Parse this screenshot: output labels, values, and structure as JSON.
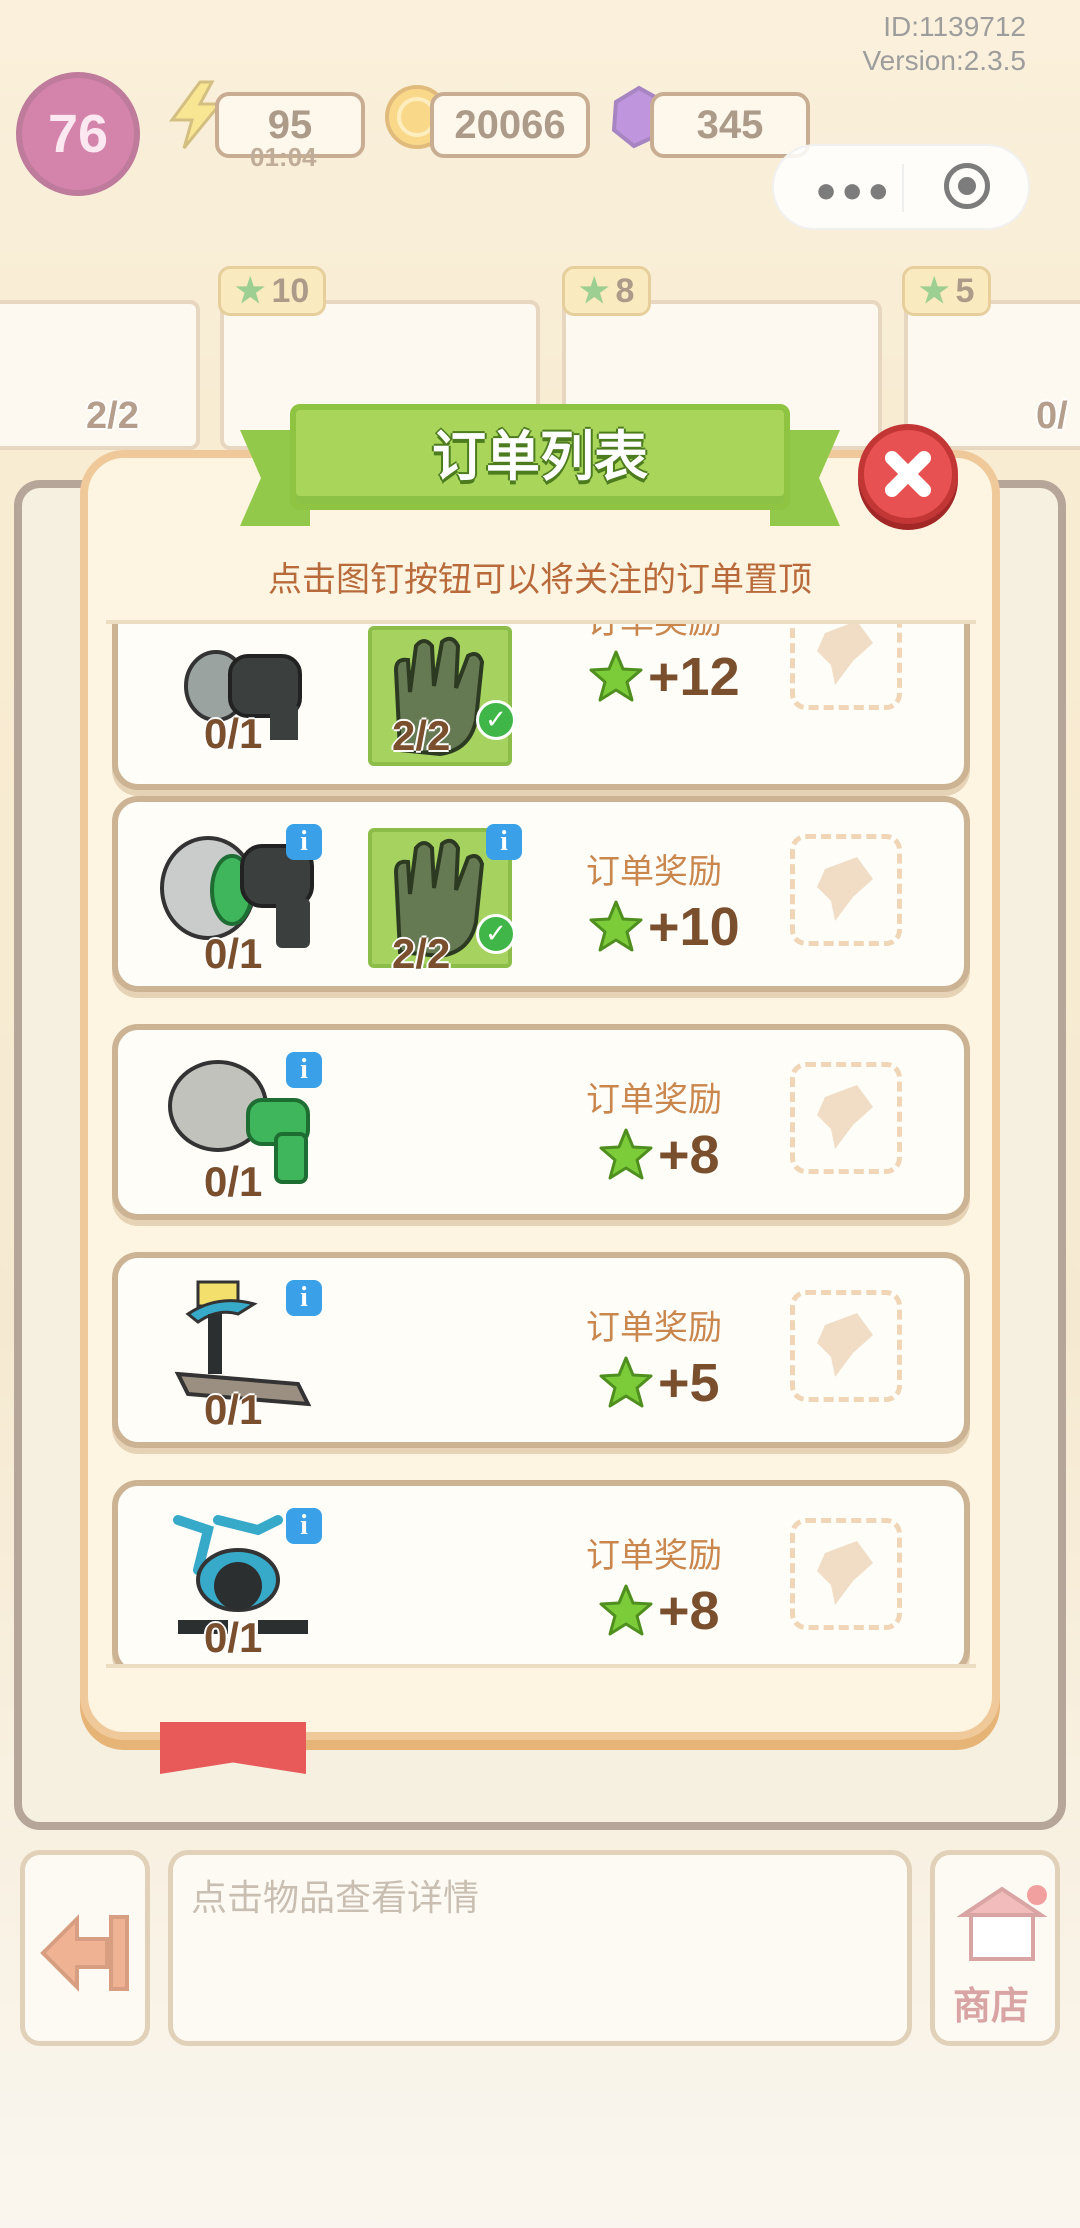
{
  "system": {
    "id_text": "ID:1139712",
    "version_text": "Version:2.3.5"
  },
  "hud": {
    "level": "76",
    "energy": "95",
    "energy_timer": "01:04",
    "coins": "20066",
    "gems": "345"
  },
  "top_orders": {
    "badges": [
      "10",
      "8",
      "5"
    ],
    "visible_counts": [
      "2/2",
      "0/"
    ]
  },
  "dialog": {
    "title": "订单列表",
    "subtitle": "点击图钉按钮可以将关注的订单置顶",
    "orders": [
      {
        "reward_label": "订单奖励",
        "reward": "+12",
        "items": [
          {
            "icon": "drill-icon",
            "count": "0/1"
          },
          {
            "icon": "glove-icon",
            "count": "2/2",
            "complete": true
          }
        ]
      },
      {
        "reward_label": "订单奖励",
        "reward": "+10",
        "items": [
          {
            "icon": "angle-grinder-icon",
            "count": "0/1"
          },
          {
            "icon": "glove-icon",
            "count": "2/2",
            "complete": true
          }
        ]
      },
      {
        "reward_label": "订单奖励",
        "reward": "+8",
        "items": [
          {
            "icon": "sander-drill-icon",
            "count": "0/1"
          }
        ]
      },
      {
        "reward_label": "订单奖励",
        "reward": "+5",
        "items": [
          {
            "icon": "treadmill-icon",
            "count": "0/1"
          }
        ]
      },
      {
        "reward_label": "订单奖励",
        "reward": "+8",
        "items": [
          {
            "icon": "exercise-bike-icon",
            "count": "0/1"
          }
        ]
      }
    ]
  },
  "bottom": {
    "placeholder": "点击物品查看详情",
    "shop_label": "商店"
  },
  "colors": {
    "accent_green": "#a9d65a",
    "close_red": "#e85151",
    "star_green": "#7ccc3a",
    "text_brown": "#7a4f2e"
  }
}
